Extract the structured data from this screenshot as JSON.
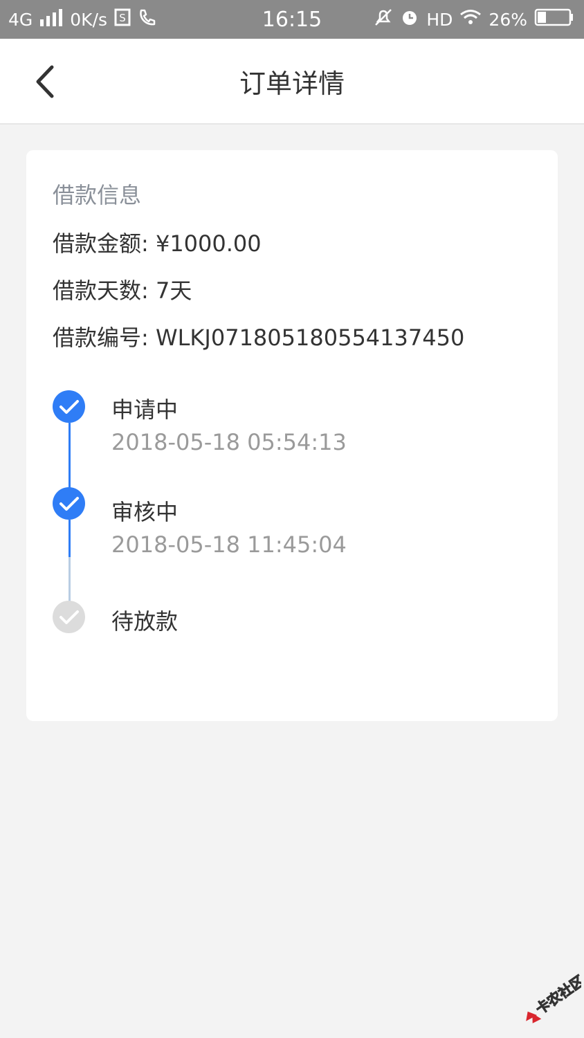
{
  "status_bar": {
    "network": "4G",
    "speed": "0K/s",
    "time": "16:15",
    "hd": "HD",
    "battery": "26%"
  },
  "nav": {
    "title": "订单详情"
  },
  "loan_info": {
    "section_title": "借款信息",
    "amount_line": "借款金额: ¥1000.00",
    "days_line": "借款天数: 7天",
    "number_line": "借款编号: WLKJ071805180554137450"
  },
  "timeline": {
    "steps": [
      {
        "label": "申请中",
        "time": "2018-05-18 05:54:13",
        "status": "done"
      },
      {
        "label": "审核中",
        "time": "2018-05-18 11:45:04",
        "status": "done"
      },
      {
        "label": "待放款",
        "status": "pending"
      }
    ]
  },
  "watermark": {
    "text": "卡农社区"
  },
  "colors": {
    "accent": "#2f7df6",
    "inactive": "#dcdcdc",
    "connector_inactive": "#b9cde3",
    "status_bar": "#8a8a8a",
    "background": "#f3f3f3"
  }
}
